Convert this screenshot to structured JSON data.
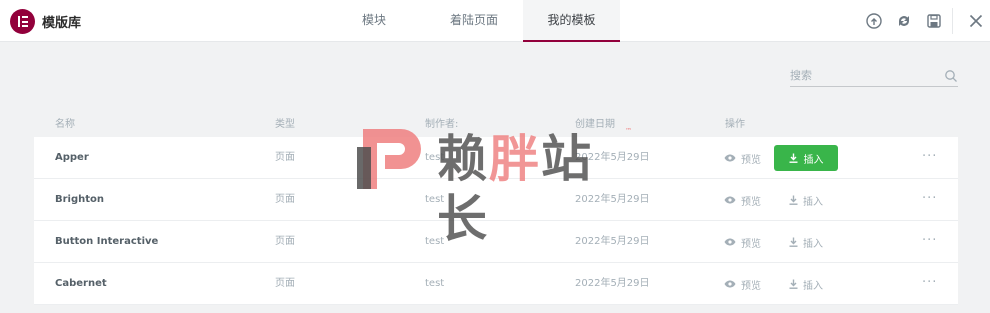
{
  "app": {
    "title": "模版库",
    "accent": "#92003b"
  },
  "tabs": [
    {
      "label": "模块",
      "active": false
    },
    {
      "label": "着陆页面",
      "active": false
    },
    {
      "label": "我的模板",
      "active": true
    }
  ],
  "header_icons": [
    "info-icon",
    "sync-icon",
    "save-icon",
    "close-icon"
  ],
  "search": {
    "placeholder": "搜索"
  },
  "columns": {
    "name": "名称",
    "type": "类型",
    "author": "制作者:",
    "date": "创建日期",
    "actions": "操作"
  },
  "rows": [
    {
      "name": "Apper",
      "type": "页面",
      "author": "test",
      "date": "2022年5月29日",
      "preview": "预览",
      "insert": "插入",
      "insert_highlighted": true
    },
    {
      "name": "Brighton",
      "type": "页面",
      "author": "test",
      "date": "2022年5月29日",
      "preview": "预览",
      "insert": "插入",
      "insert_highlighted": false
    },
    {
      "name": "Button Interactive",
      "type": "页面",
      "author": "test",
      "date": "2022年5月29日",
      "preview": "预览",
      "insert": "插入",
      "insert_highlighted": false
    },
    {
      "name": "Cabernet",
      "type": "页面",
      "author": "test",
      "date": "2022年5月29日",
      "preview": "预览",
      "insert": "插入",
      "insert_highlighted": false
    }
  ],
  "more_label": "···",
  "watermark": {
    "text_1": "赖",
    "text_2": "胖",
    "text_3": "站长",
    "tm": "™",
    "colors": {
      "dark": "#4f4f4f",
      "pink": "#ef7f7f"
    }
  },
  "colors": {
    "insert_button": "#39b54a",
    "background": "#f1f2f3"
  }
}
